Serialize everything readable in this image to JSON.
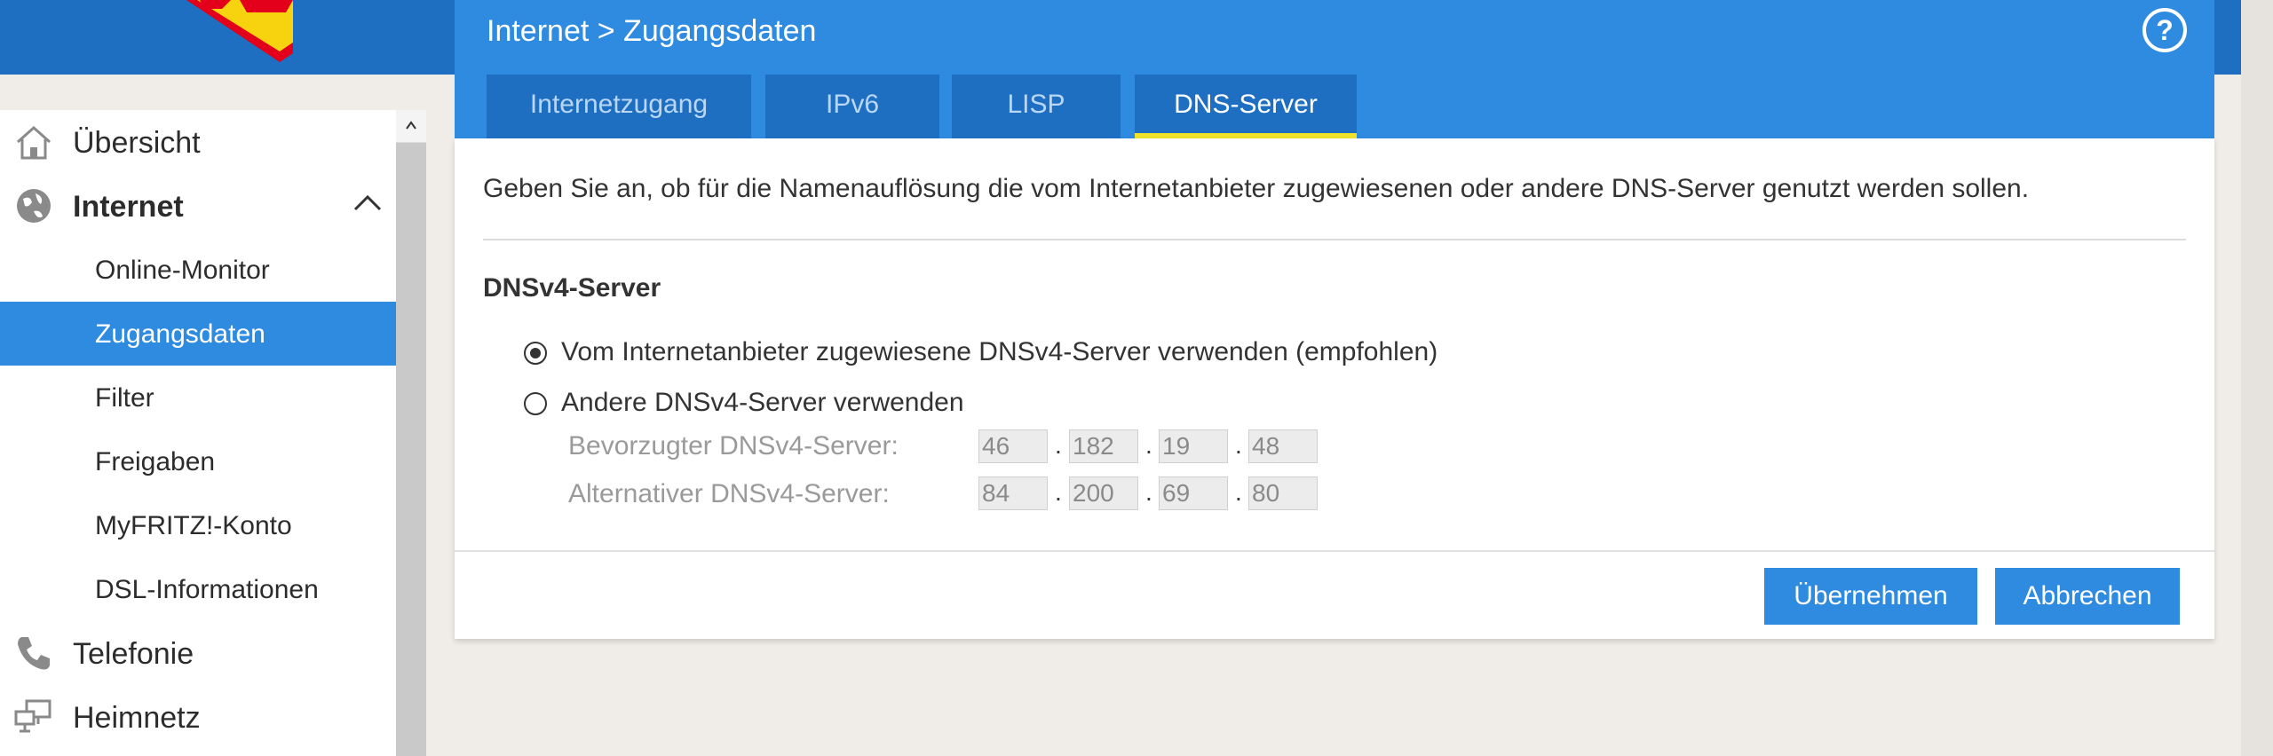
{
  "sidebar": {
    "items": [
      {
        "label": "Übersicht",
        "icon": "home-icon"
      },
      {
        "label": "Internet",
        "icon": "globe-icon"
      },
      {
        "label": "Online-Monitor"
      },
      {
        "label": "Zugangsdaten"
      },
      {
        "label": "Filter"
      },
      {
        "label": "Freigaben"
      },
      {
        "label": "MyFRITZ!-Konto"
      },
      {
        "label": "DSL-Informationen"
      },
      {
        "label": "Telefonie",
        "icon": "phone-icon"
      },
      {
        "label": "Heimnetz",
        "icon": "network-icon"
      }
    ]
  },
  "header": {
    "breadcrumb": "Internet > Zugangsdaten",
    "tabs": [
      {
        "label": "Internetzugang"
      },
      {
        "label": "IPv6"
      },
      {
        "label": "LISP"
      },
      {
        "label": "DNS-Server"
      }
    ]
  },
  "content": {
    "intro": "Geben Sie an, ob für die Namenauflösung die vom Internetanbieter zugewiesenen oder andere DNS-Server genutzt werden sollen.",
    "section_title": "DNSv4-Server",
    "option_provider": "Vom Internetanbieter zugewiesene DNSv4-Server verwenden (empfohlen)",
    "option_other": "Andere DNSv4-Server verwenden",
    "preferred_label": "Bevorzugter DNSv4-Server:",
    "preferred_ip": [
      "46",
      "182",
      "19",
      "48"
    ],
    "alternative_label": "Alternativer DNSv4-Server:",
    "alternative_ip": [
      "84",
      "200",
      "69",
      "80"
    ]
  },
  "buttons": {
    "apply": "Übernehmen",
    "cancel": "Abbrechen"
  },
  "colors": {
    "accent": "#2e8be0",
    "header_dark": "#1e6fc2",
    "tab_underline": "#f1e22b"
  }
}
